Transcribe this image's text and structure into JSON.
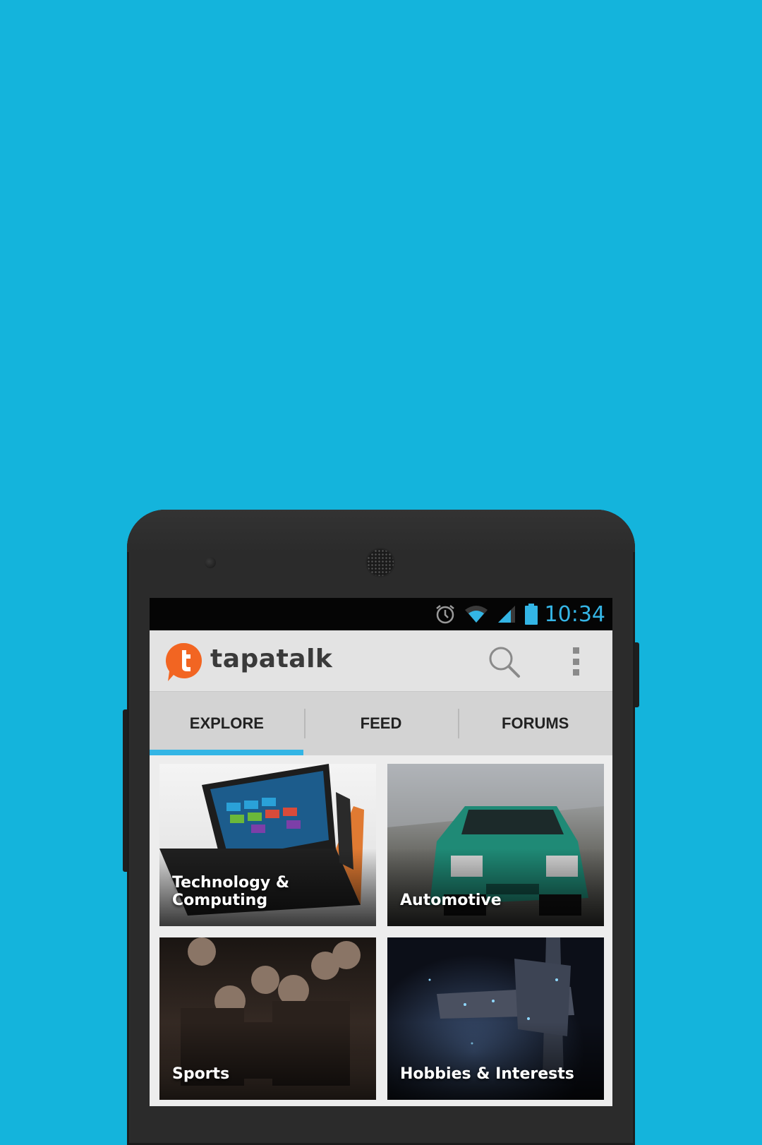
{
  "status_bar": {
    "time": "10:34",
    "icons": [
      "alarm-icon",
      "wifi-icon",
      "signal-icon",
      "battery-icon"
    ]
  },
  "action_bar": {
    "app_name": "tapatalk",
    "icons": [
      "tapatalk-logo-icon",
      "search-icon",
      "overflow-menu-icon"
    ]
  },
  "tabs": [
    {
      "label": "EXPLORE",
      "selected": true
    },
    {
      "label": "FEED",
      "selected": false
    },
    {
      "label": "FORUMS",
      "selected": false
    }
  ],
  "categories": [
    {
      "label": "Technology & Computing"
    },
    {
      "label": "Automotive"
    },
    {
      "label": "Sports"
    },
    {
      "label": "Hobbies & Interests"
    }
  ],
  "colors": {
    "background": "#14b4dc",
    "accent": "#33b5e5",
    "logo": "#f26522"
  }
}
